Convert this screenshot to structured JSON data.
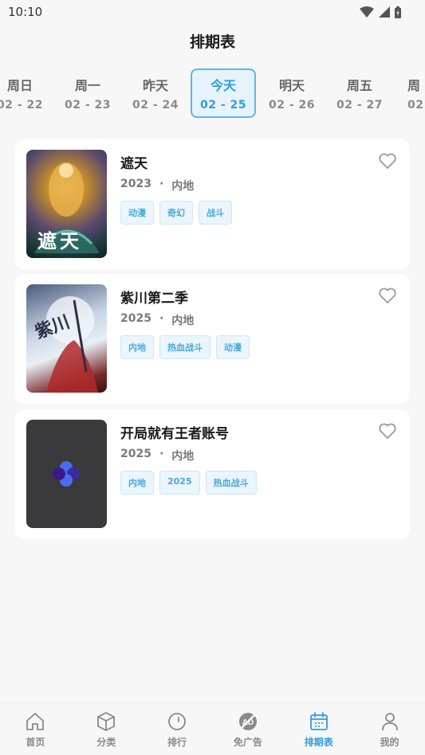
{
  "status": {
    "time": "10:10"
  },
  "page_title": "排期表",
  "days": [
    {
      "name": "周日",
      "date": "02 - 22"
    },
    {
      "name": "周一",
      "date": "02 - 23"
    },
    {
      "name": "昨天",
      "date": "02 - 24"
    },
    {
      "name": "今天",
      "date": "02 - 25"
    },
    {
      "name": "明天",
      "date": "02 - 26"
    },
    {
      "name": "周五",
      "date": "02 - 27"
    },
    {
      "name": "周",
      "date": "02"
    }
  ],
  "shows": [
    {
      "title": "遮天",
      "year": "2023",
      "dot": "·",
      "region": "内地",
      "tags": [
        "动漫",
        "奇幻",
        "战斗"
      ],
      "poster_text": "遮天"
    },
    {
      "title": "紫川第二季",
      "year": "2025",
      "dot": "·",
      "region": "内地",
      "tags": [
        "内地",
        "热血战斗",
        "动漫"
      ],
      "poster_text": "紫川"
    },
    {
      "title": "开局就有王者账号",
      "year": "2025",
      "dot": "·",
      "region": "内地",
      "tags": [
        "内地",
        "2025",
        "热血战斗"
      ]
    }
  ],
  "nav": [
    {
      "label": "首页",
      "icon": "home-icon"
    },
    {
      "label": "分类",
      "icon": "cube-icon"
    },
    {
      "label": "排行",
      "icon": "ranking-icon"
    },
    {
      "label": "免广告",
      "icon": "no-ads-icon"
    },
    {
      "label": "排期表",
      "icon": "calendar-icon"
    },
    {
      "label": "我的",
      "icon": "profile-icon"
    }
  ],
  "colors": {
    "accent": "#2b9ee0",
    "tag_text": "#4aa8dd",
    "background": "#f7f7f8"
  }
}
